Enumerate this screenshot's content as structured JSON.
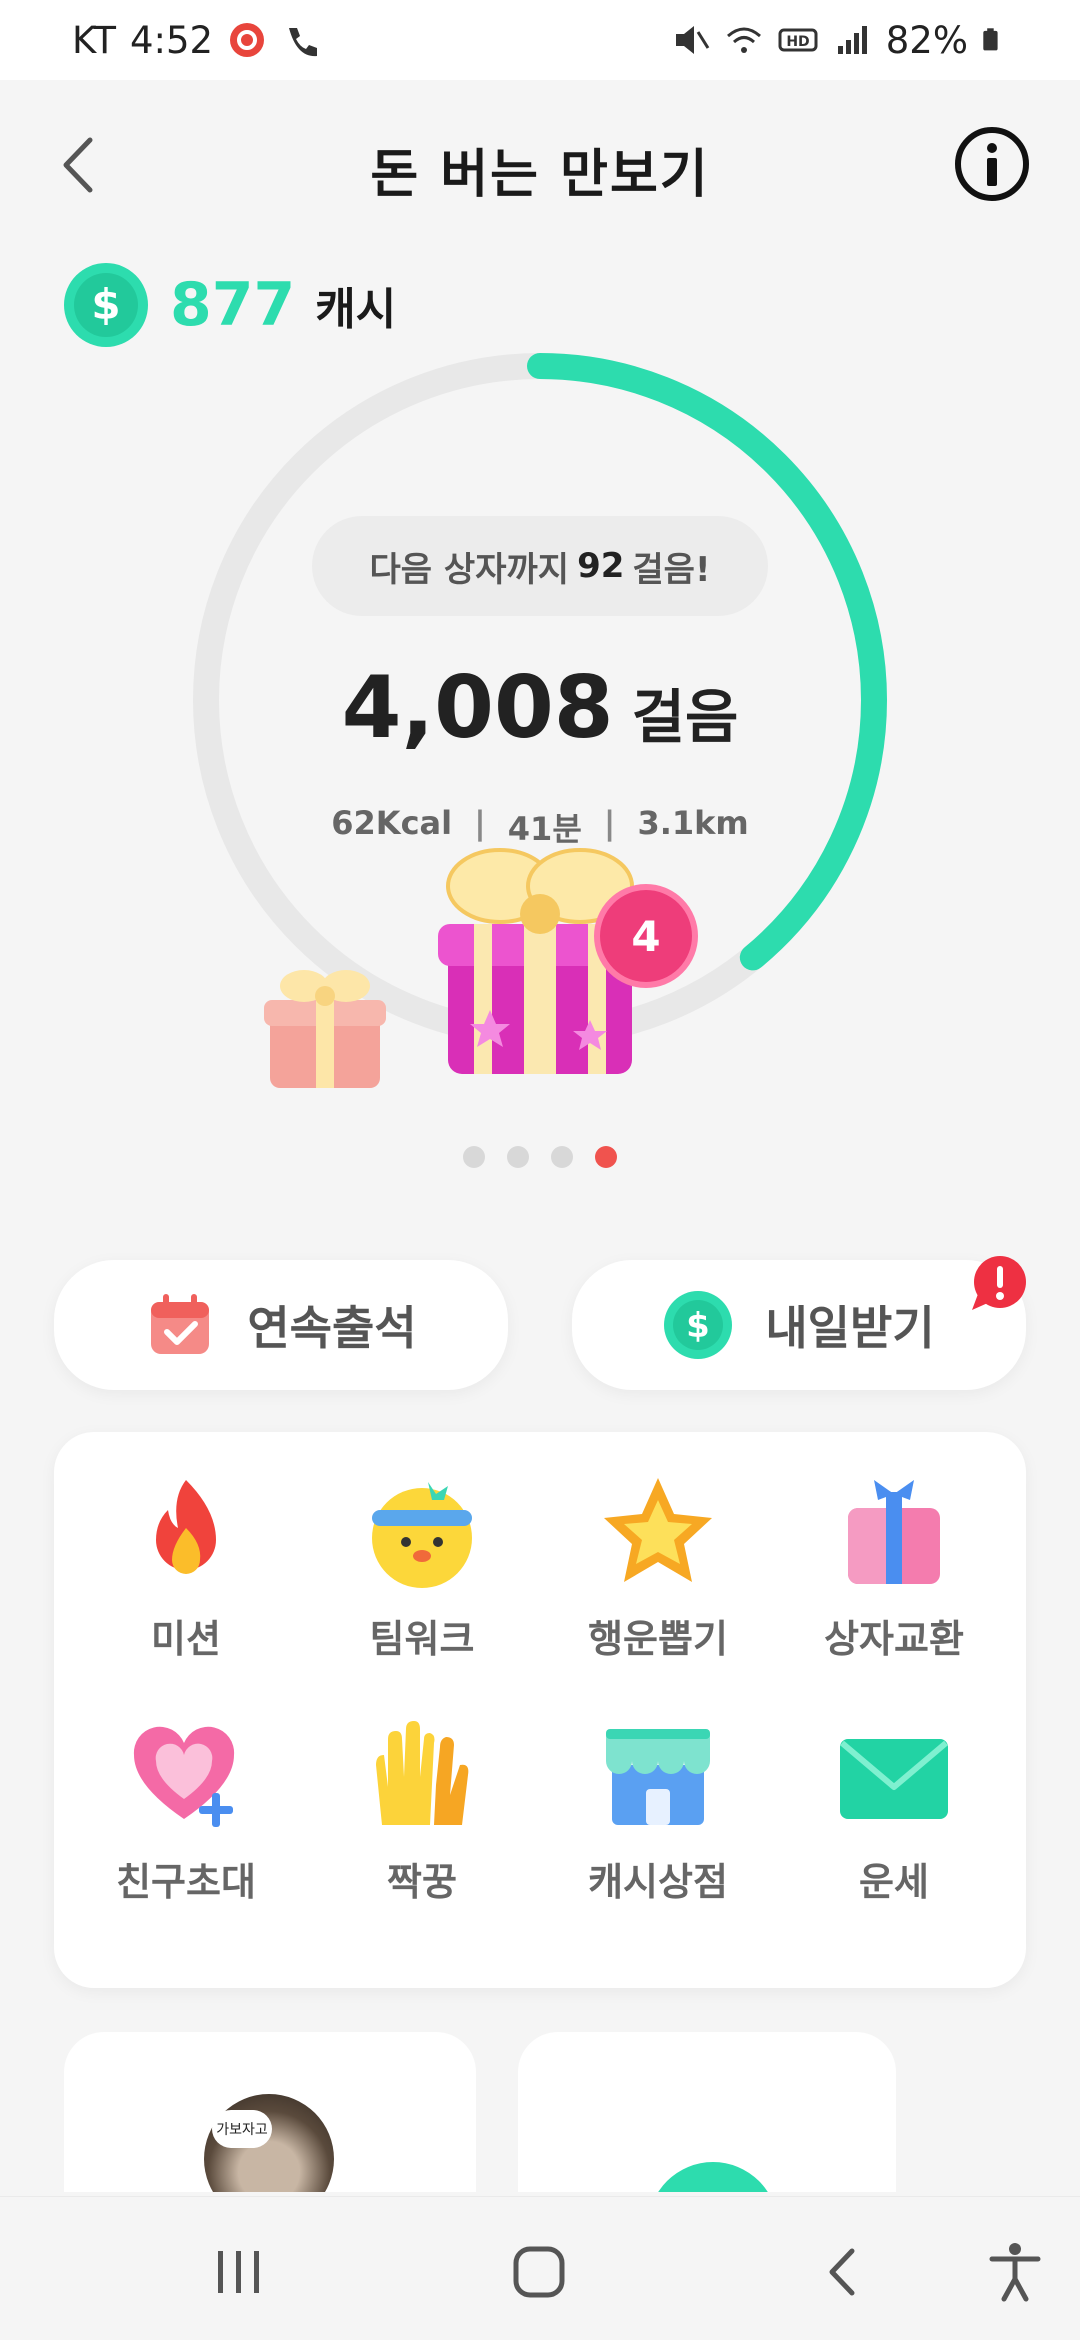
{
  "status_bar": {
    "carrier": "KT",
    "time": "4:52",
    "battery": "82%"
  },
  "header": {
    "title": "돈 버는 만보기",
    "back_icon": "chevron-left-icon",
    "info_icon": "info-icon"
  },
  "cash": {
    "amount": "877",
    "unit": "캐시",
    "icon": "dollar-coin-icon"
  },
  "progress": {
    "next_box_prefix": "다음 상자까지",
    "next_box_count": "92",
    "next_box_suffix": "걸음!",
    "steps": "4,008",
    "steps_unit": "걸음",
    "kcal": "62Kcal",
    "minutes": "41분",
    "distance": "3.1km",
    "ring_fraction": 0.39,
    "ring_color": "#2ddcae",
    "gift_badge": "4"
  },
  "pager": {
    "count": 4,
    "active_index": 3
  },
  "actions": {
    "attendance_label": "연속출석",
    "tomorrow_label": "내일받기"
  },
  "grid": {
    "items": [
      {
        "label": "미션",
        "icon": "fire-icon"
      },
      {
        "label": "팀워크",
        "icon": "chick-headband-icon"
      },
      {
        "label": "행운뽑기",
        "icon": "star-icon"
      },
      {
        "label": "상자교환",
        "icon": "gift-box-icon"
      },
      {
        "label": "친구초대",
        "icon": "heart-plus-icon"
      },
      {
        "label": "짝꿍",
        "icon": "high-five-hands-icon"
      },
      {
        "label": "캐시상점",
        "icon": "store-icon"
      },
      {
        "label": "운세",
        "icon": "envelope-icon"
      }
    ]
  },
  "bottom": {
    "avatar_bubble": "가보자고"
  }
}
